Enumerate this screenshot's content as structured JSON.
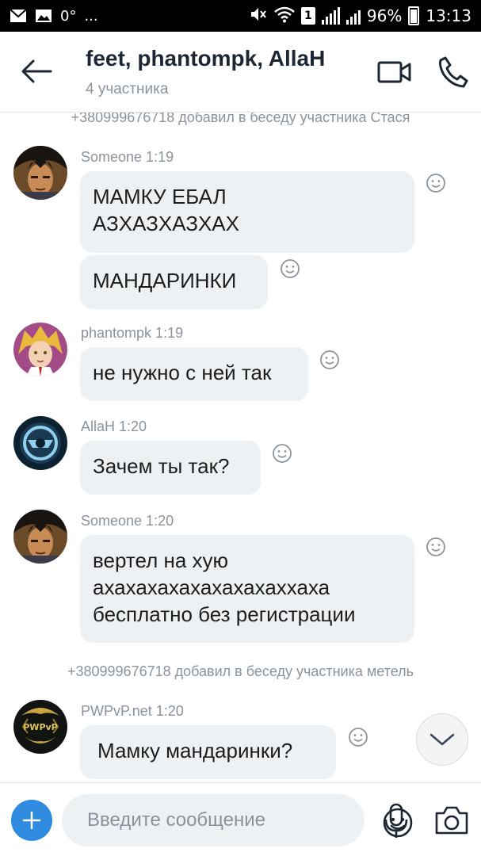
{
  "status_bar": {
    "temperature": "0°",
    "more": "...",
    "sim": "1",
    "battery": "96%",
    "time": "13:13"
  },
  "header": {
    "title": "feet, phantompk, AllaH",
    "subtitle": "4 участника"
  },
  "messages": {
    "sys1": "+380999676718 добавил в беседу участника Стася",
    "g1_sender": "Someone 1:19",
    "g1_m1_l1": "МАМКУ ЕБАЛ",
    "g1_m1_l2": "АЗХАЗХАЗХАХ",
    "g1_m2": "МАНДАРИНКИ",
    "g2_sender": "phantompk 1:19",
    "g2_m1": "не нужно с ней так",
    "g3_sender": "AllaH 1:20",
    "g3_m1": "Зачем ты так?",
    "g4_sender": "Someone 1:20",
    "g4_m1_l1": "вертел на хую",
    "g4_m1_l2": "ахахахахахахахахаххаха",
    "g4_m1_l3": "бесплатно без регистрации",
    "sys2": "+380999676718 добавил в беседу участника метель",
    "g5_sender": "PWPvP.net 1:20",
    "g5_m1": "Мамку мандаринки?",
    "g5_avatar_text": "PWPvP"
  },
  "composer": {
    "placeholder": "Введите сообщение"
  },
  "colors": {
    "accent": "#2e8be0",
    "bubble": "#eef1f4",
    "meta": "#8a939c"
  }
}
